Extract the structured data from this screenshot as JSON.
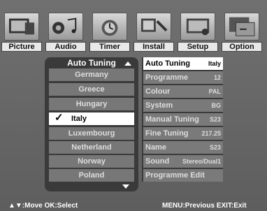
{
  "tabs": [
    {
      "label": "Picture",
      "icon": "picture-icon"
    },
    {
      "label": "Audio",
      "icon": "audio-icon"
    },
    {
      "label": "Timer",
      "icon": "timer-icon"
    },
    {
      "label": "Install",
      "icon": "install-icon"
    },
    {
      "label": "Setup",
      "icon": "setup-icon"
    },
    {
      "label": "Option",
      "icon": "option-icon"
    }
  ],
  "list": {
    "title": "Auto Tuning",
    "items": [
      "Germany",
      "Greece",
      "Hungary",
      "Italy",
      "Luxembourg",
      "Netherland",
      "Norway",
      "Poland"
    ],
    "selected": "Italy",
    "check_mark": "✓"
  },
  "settings": [
    {
      "label": "Auto Tuning",
      "value": "Italy"
    },
    {
      "label": "Programme",
      "value": "12"
    },
    {
      "label": "Colour",
      "value": "PAL"
    },
    {
      "label": "System",
      "value": "BG"
    },
    {
      "label": "Manual Tuning",
      "value": "S23"
    },
    {
      "label": "Fine Tuning",
      "value": "217.25"
    },
    {
      "label": "Name",
      "value": "S23"
    },
    {
      "label": "Sound",
      "value": "Stereo/Dual1"
    },
    {
      "label": "Programme Edit",
      "value": ""
    }
  ],
  "help": {
    "left": "▲▼:Move  OK:Select",
    "right": "MENU:Previous   EXIT:Exit"
  },
  "colors": {
    "background": "#6b6b6b",
    "panel": "#3a3a3a",
    "item": "#777777",
    "selected": "#ffffff"
  }
}
